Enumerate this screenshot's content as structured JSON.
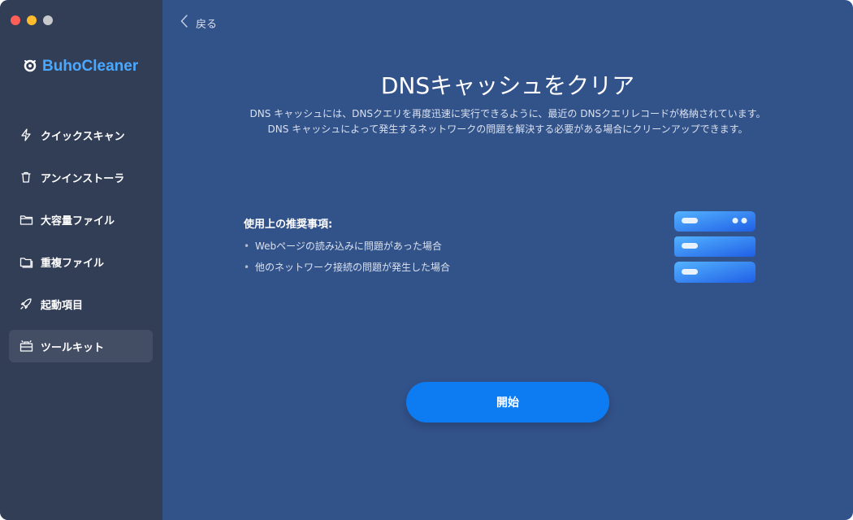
{
  "app": {
    "name": "BuhoCleaner"
  },
  "sidebar": {
    "items": [
      {
        "label": "クイックスキャン",
        "icon": "lightning-icon"
      },
      {
        "label": "アンインストーラ",
        "icon": "trash-icon"
      },
      {
        "label": "大容量ファイル",
        "icon": "folder-icon"
      },
      {
        "label": "重複ファイル",
        "icon": "duplicate-folder-icon"
      },
      {
        "label": "起動項目",
        "icon": "rocket-icon"
      },
      {
        "label": "ツールキット",
        "icon": "toolbox-icon",
        "active": true
      }
    ]
  },
  "header": {
    "back_label": "戻る"
  },
  "main": {
    "title": "DNSキャッシュをクリア",
    "description": "DNS キャッシュには、DNSクエリを再度迅速に実行できるように、最近の DNSクエリレコードが格納されています。DNS キャッシュによって発生するネットワークの問題を解決する必要がある場合にクリーンアップできます。",
    "recommendation_title": "使用上の推奨事項:",
    "recommendations": [
      "Webページの読み込みに問題があった場合",
      "他のネットワーク接続の問題が発生した場合"
    ],
    "illustration_icon": "server-stack-icon",
    "start_label": "開始"
  },
  "colors": {
    "sidebar_bg": "#323e56",
    "main_bg": "#32528a",
    "accent": "#0d7cf2",
    "brand": "#4aa8ff"
  }
}
